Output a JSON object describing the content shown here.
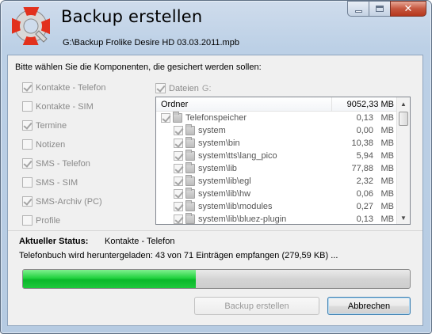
{
  "window": {
    "title": "Backup erstellen",
    "subtitle": "G:\\Backup Frolike Desire HD 03.03.2011.mpb",
    "caption_buttons": {
      "minimize_icon": "minimize-icon",
      "maximize_icon": "maximize-icon",
      "close_icon": "close-icon",
      "close_glyph": "✕"
    }
  },
  "prompt": "Bitte wählen Sie die Komponenten, die gesichert werden sollen:",
  "components": [
    {
      "label": "Kontakte - Telefon",
      "checked": true
    },
    {
      "label": "Kontakte - SIM",
      "checked": false
    },
    {
      "label": "Termine",
      "checked": true
    },
    {
      "label": "Notizen",
      "checked": false
    },
    {
      "label": "SMS - Telefon",
      "checked": true
    },
    {
      "label": "SMS - SIM",
      "checked": false
    },
    {
      "label": "SMS-Archiv (PC)",
      "checked": true
    },
    {
      "label": "Profile",
      "checked": false
    }
  ],
  "files": {
    "label": "Dateien",
    "checked": true,
    "drive": "G:"
  },
  "tree": {
    "header": {
      "name": "Ordner",
      "size": "9052,33 MB"
    },
    "rows": [
      {
        "name": "Telefonspeicher",
        "num": "0,13",
        "unit": "MB",
        "level": 0,
        "checked": true
      },
      {
        "name": "system",
        "num": "0,00",
        "unit": "MB",
        "level": 1,
        "checked": true
      },
      {
        "name": "system\\bin",
        "num": "10,38",
        "unit": "MB",
        "level": 1,
        "checked": true
      },
      {
        "name": "system\\tts\\lang_pico",
        "num": "5,94",
        "unit": "MB",
        "level": 1,
        "checked": true
      },
      {
        "name": "system\\lib",
        "num": "77,88",
        "unit": "MB",
        "level": 1,
        "checked": true
      },
      {
        "name": "system\\lib\\egl",
        "num": "2,32",
        "unit": "MB",
        "level": 1,
        "checked": true
      },
      {
        "name": "system\\lib\\hw",
        "num": "0,06",
        "unit": "MB",
        "level": 1,
        "checked": true
      },
      {
        "name": "system\\lib\\modules",
        "num": "0,27",
        "unit": "MB",
        "level": 1,
        "checked": true
      },
      {
        "name": "system\\lib\\bluez-plugin",
        "num": "0,13",
        "unit": "MB",
        "level": 1,
        "checked": true
      }
    ]
  },
  "status": {
    "label": "Aktueller Status:",
    "value": "Kontakte - Telefon",
    "detail": "Telefonbuch wird heruntergeladen: 43 von 71 Einträgen empfangen (279,59 KB) ..."
  },
  "progress": {
    "fraction": 0.447
  },
  "buttons": {
    "backup": "Backup erstellen",
    "cancel": "Abbrechen"
  },
  "colors": {
    "progress_green": "#22d23f",
    "close_red": "#c6573f",
    "title_glass": "#bcd0e6"
  }
}
